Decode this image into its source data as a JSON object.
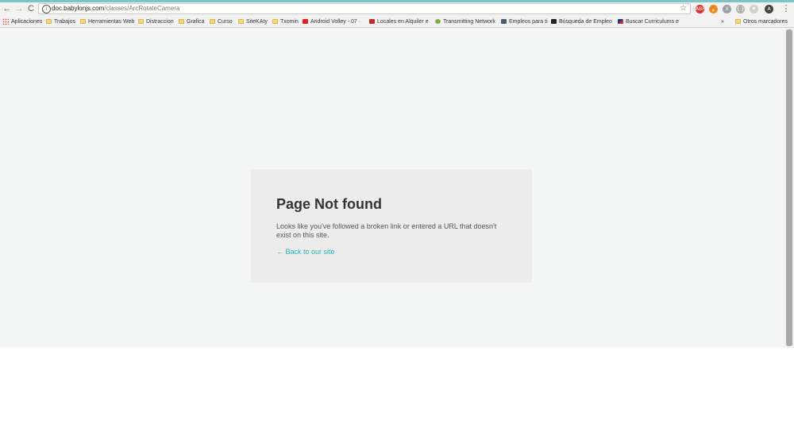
{
  "browser": {
    "url_domain": "doc.babylonjs.com",
    "url_path": "/classes/ArcRotateCamera",
    "back_glyph": "←",
    "forward_glyph": "→",
    "reload_glyph": "C",
    "info_glyph": "i",
    "star_glyph": "☆",
    "menu_glyph": "⋮",
    "extensions": [
      {
        "name": "adblock-extension-icon",
        "glyph": "ABP",
        "color": "#d9342b"
      },
      {
        "name": "fire-extension-icon",
        "glyph": "🔥",
        "color": "#f08c2a"
      },
      {
        "name": "translate-extension-icon",
        "glyph": "X",
        "color": "#9aa0a6"
      },
      {
        "name": "code-extension-icon",
        "glyph": "{ }",
        "color": "#b0b0b0"
      },
      {
        "name": "flag-extension-icon",
        "glyph": "⚑",
        "color": "#cfcfcf"
      },
      {
        "name": "account-avatar-icon",
        "glyph": "A",
        "color": "#444444"
      }
    ]
  },
  "bookmarks": {
    "apps_label": "Aplicaciones",
    "items": [
      {
        "label": "Trabajos"
      },
      {
        "label": "Herramientas Web"
      },
      {
        "label": "Distraccion"
      },
      {
        "label": "Grafica"
      },
      {
        "label": "Curso"
      },
      {
        "label": "SiteKAty"
      },
      {
        "label": "Txomin"
      },
      {
        "label": "Android Volley - 07 ·"
      },
      {
        "label": "Locales en Alquiler e"
      },
      {
        "label": "Transmitting Network"
      },
      {
        "label": "Empleos para ti"
      },
      {
        "label": "Búsqueda de Empleo"
      },
      {
        "label": "Buscar Curriculums e"
      }
    ],
    "overflow_glyph": "»",
    "other_label": "Otros marcadores"
  },
  "content": {
    "title": "Page Not found",
    "message": "Looks like you've followed a broken link or entered a URL that doesn't exist on this site.",
    "back_link": "← Back to our site"
  }
}
